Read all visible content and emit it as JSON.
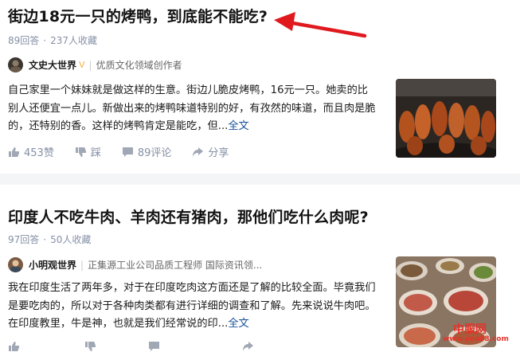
{
  "posts": [
    {
      "title": "街边18元一只的烤鸭，到底能不能吃?",
      "answers": "89回答",
      "favorites": "237人收藏",
      "author": "文史大世界",
      "author_badge": "V",
      "author_desc": "优质文化领域创作者",
      "excerpt": "自己家里一个妹妹就是做这样的生意。街边儿脆皮烤鸭，16元一只。她卖的比别人还便宜一点儿。新做出来的烤鸭味道特别的好，有孜然的味道，而且肉是脆的，还特别的香。这样的烤鸭肯定是能吃，但...",
      "more": "全文",
      "likes": "453赞",
      "dislike": "踩",
      "comments": "89评论",
      "share": "分享"
    },
    {
      "title": "印度人不吃牛肉、羊肉还有猪肉，那他们吃什么肉呢?",
      "answers": "97回答",
      "favorites": "50人收藏",
      "author": "小明观世界",
      "author_desc": "正集源工业公司品质工程师 国际资讯领...",
      "excerpt": "我在印度生活了两年多，对于在印度吃肉这方面还是了解的比较全面。毕竟我们是要吃肉的，所以对于各种肉类都有进行详细的调查和了解。先来说说牛肉吧。在印度教里，牛是神，也就是我们经常说的印...",
      "more": "全文"
    }
  ],
  "watermark": {
    "top": "中服网",
    "bottom": "www.yoo88.com"
  },
  "colors": {
    "arrow": "#e0191e",
    "link": "#175199",
    "meta": "#8590a6",
    "divider": "#f4f5f7",
    "watermark_red": "#e6332a"
  }
}
